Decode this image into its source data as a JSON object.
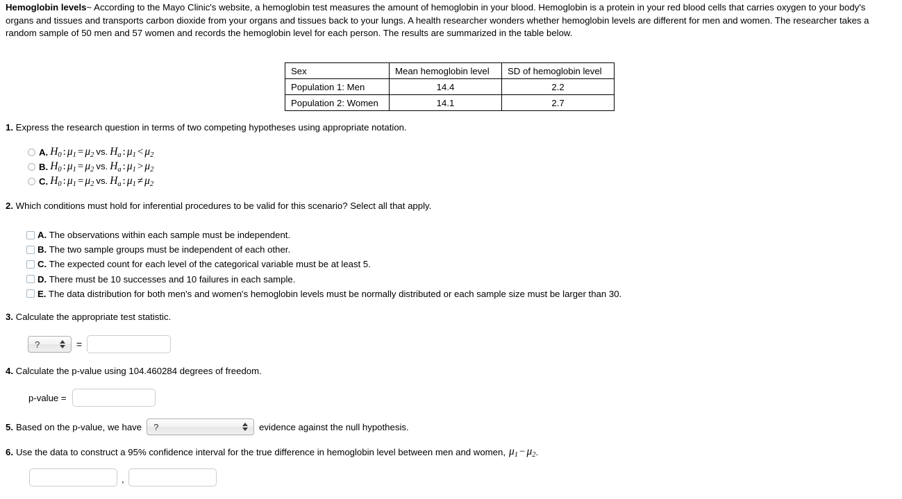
{
  "intro": {
    "title": "Hemoglobin levels",
    "separator": "~",
    "body": "According to the Mayo Clinic's website, a hemoglobin test measures the amount of hemoglobin in your blood. Hemoglobin is a protein in your red blood cells that carries oxygen to your body's organs and tissues and transports carbon dioxide from your organs and tissues back to your lungs. A health researcher wonders whether hemoglobin levels are different for men and women. The researcher takes a random sample of 50 men and 57 women and records the hemoglobin level for each person. The results are summarized in the table below."
  },
  "table": {
    "headers": [
      "Sex",
      "Mean hemoglobin level",
      "SD of hemoglobin level"
    ],
    "rows": [
      {
        "sex": "Population 1: Men",
        "mean": "14.4",
        "sd": "2.2"
      },
      {
        "sex": "Population 2: Women",
        "mean": "14.1",
        "sd": "2.7"
      }
    ]
  },
  "q1": {
    "number": "1.",
    "prompt": "Express the research question in terms of two competing hypotheses using appropriate notation.",
    "options": [
      {
        "letter": "A.",
        "null_left": "H",
        "null_sub": "0",
        "mu1": "μ",
        "mu1sub": "1",
        "eq": "=",
        "mu2": "μ",
        "mu2sub": "2",
        "vs": "vs.",
        "alt": "H",
        "alt_sub": "a",
        "amu1": "μ",
        "amu1sub": "1",
        "rel": "<",
        "amu2": "μ",
        "amu2sub": "2"
      },
      {
        "letter": "B.",
        "null_left": "H",
        "null_sub": "0",
        "mu1": "μ",
        "mu1sub": "1",
        "eq": "=",
        "mu2": "μ",
        "mu2sub": "2",
        "vs": "vs.",
        "alt": "H",
        "alt_sub": "a",
        "amu1": "μ",
        "amu1sub": "1",
        "rel": ">",
        "amu2": "μ",
        "amu2sub": "2"
      },
      {
        "letter": "C.",
        "null_left": "H",
        "null_sub": "0",
        "mu1": "μ",
        "mu1sub": "1",
        "eq": "=",
        "mu2": "μ",
        "mu2sub": "2",
        "vs": "vs.",
        "alt": "H",
        "alt_sub": "a",
        "amu1": "μ",
        "amu1sub": "1",
        "rel": "≠",
        "amu2": "μ",
        "amu2sub": "2"
      }
    ],
    "colon": ":"
  },
  "q2": {
    "number": "2.",
    "prompt": "Which conditions must hold for inferential procedures to be valid for this scenario? Select all that apply.",
    "options": [
      {
        "letter": "A.",
        "text": "The observations within each sample must be independent."
      },
      {
        "letter": "B.",
        "text": "The two sample groups must be independent of each other."
      },
      {
        "letter": "C.",
        "text": "The expected count for each level of the categorical variable must be at least 5."
      },
      {
        "letter": "D.",
        "text": "There must be 10 successes and 10 failures in each sample."
      },
      {
        "letter": "E.",
        "text": "The data distribution for both men's and women's hemoglobin levels must be normally distributed or each sample size must be larger than 30."
      }
    ]
  },
  "q3": {
    "number": "3.",
    "prompt": "Calculate the appropriate test statistic.",
    "select_value": "?",
    "equals": "=",
    "input_value": "",
    "input_placeholder": ""
  },
  "q4": {
    "number": "4.",
    "prompt": "Calculate the p-value using 104.460284 degrees of freedom.",
    "label": "p-value =",
    "input_value": "",
    "input_placeholder": ""
  },
  "q5": {
    "number": "5.",
    "prompt_before": "Based on the p-value, we have",
    "select_value": "?",
    "prompt_after": "evidence against the null hypothesis."
  },
  "q6": {
    "number": "6.",
    "prompt_before": "Use the data to construct a 95% confidence interval for the true difference in hemoglobin level between men and women,",
    "mu1": "μ",
    "mu1sub": "1",
    "minus": "−",
    "mu2": "μ",
    "mu2sub": "2",
    "period": ".",
    "separator": ",",
    "lower_value": "",
    "upper_value": "",
    "input_placeholder": ""
  }
}
